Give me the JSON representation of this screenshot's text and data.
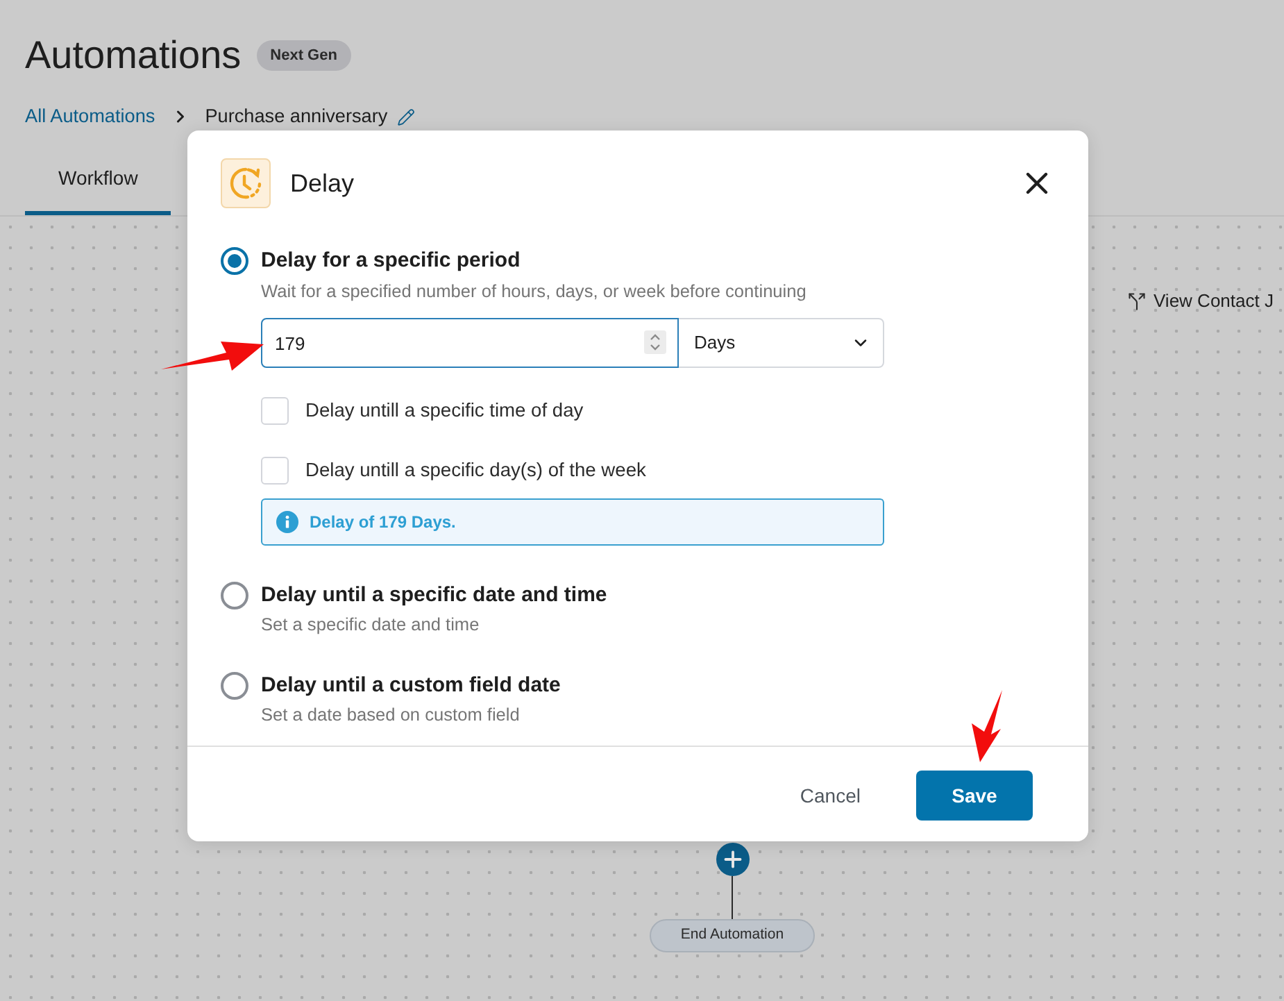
{
  "header": {
    "title": "Automations",
    "badge": "Next Gen"
  },
  "breadcrumb": [
    {
      "label": "All Automations",
      "kind": "link",
      "editable": false
    },
    {
      "label": "Purchase anniversary",
      "kind": "current",
      "editable": true
    }
  ],
  "tabs": [
    {
      "label": "Workflow",
      "selected": true
    }
  ],
  "canvas": {
    "journey_link": "View Contact J",
    "end_node": "End Automation"
  },
  "dialog": {
    "title": "Delay",
    "options": [
      {
        "title": "Delay for a specific period",
        "description": "Wait for a specified number of hours, days, or week before continuing",
        "selected": true,
        "settings": {
          "amount": "179",
          "unit": "Days",
          "checks": [
            {
              "label": "Delay untill a specific time of day",
              "checked": false
            },
            {
              "label": "Delay untill a specific day(s) of the week",
              "checked": false
            }
          ],
          "info": "Delay of 179 Days."
        }
      },
      {
        "title": "Delay until a specific date and time",
        "description": "Set a specific date and time",
        "selected": false
      },
      {
        "title": "Delay until a custom field date",
        "description": "Set a date based on custom field",
        "selected": false
      }
    ],
    "buttons": [
      {
        "label": "Cancel",
        "kind": "secondary"
      },
      {
        "label": "Save",
        "kind": "primary"
      }
    ]
  }
}
